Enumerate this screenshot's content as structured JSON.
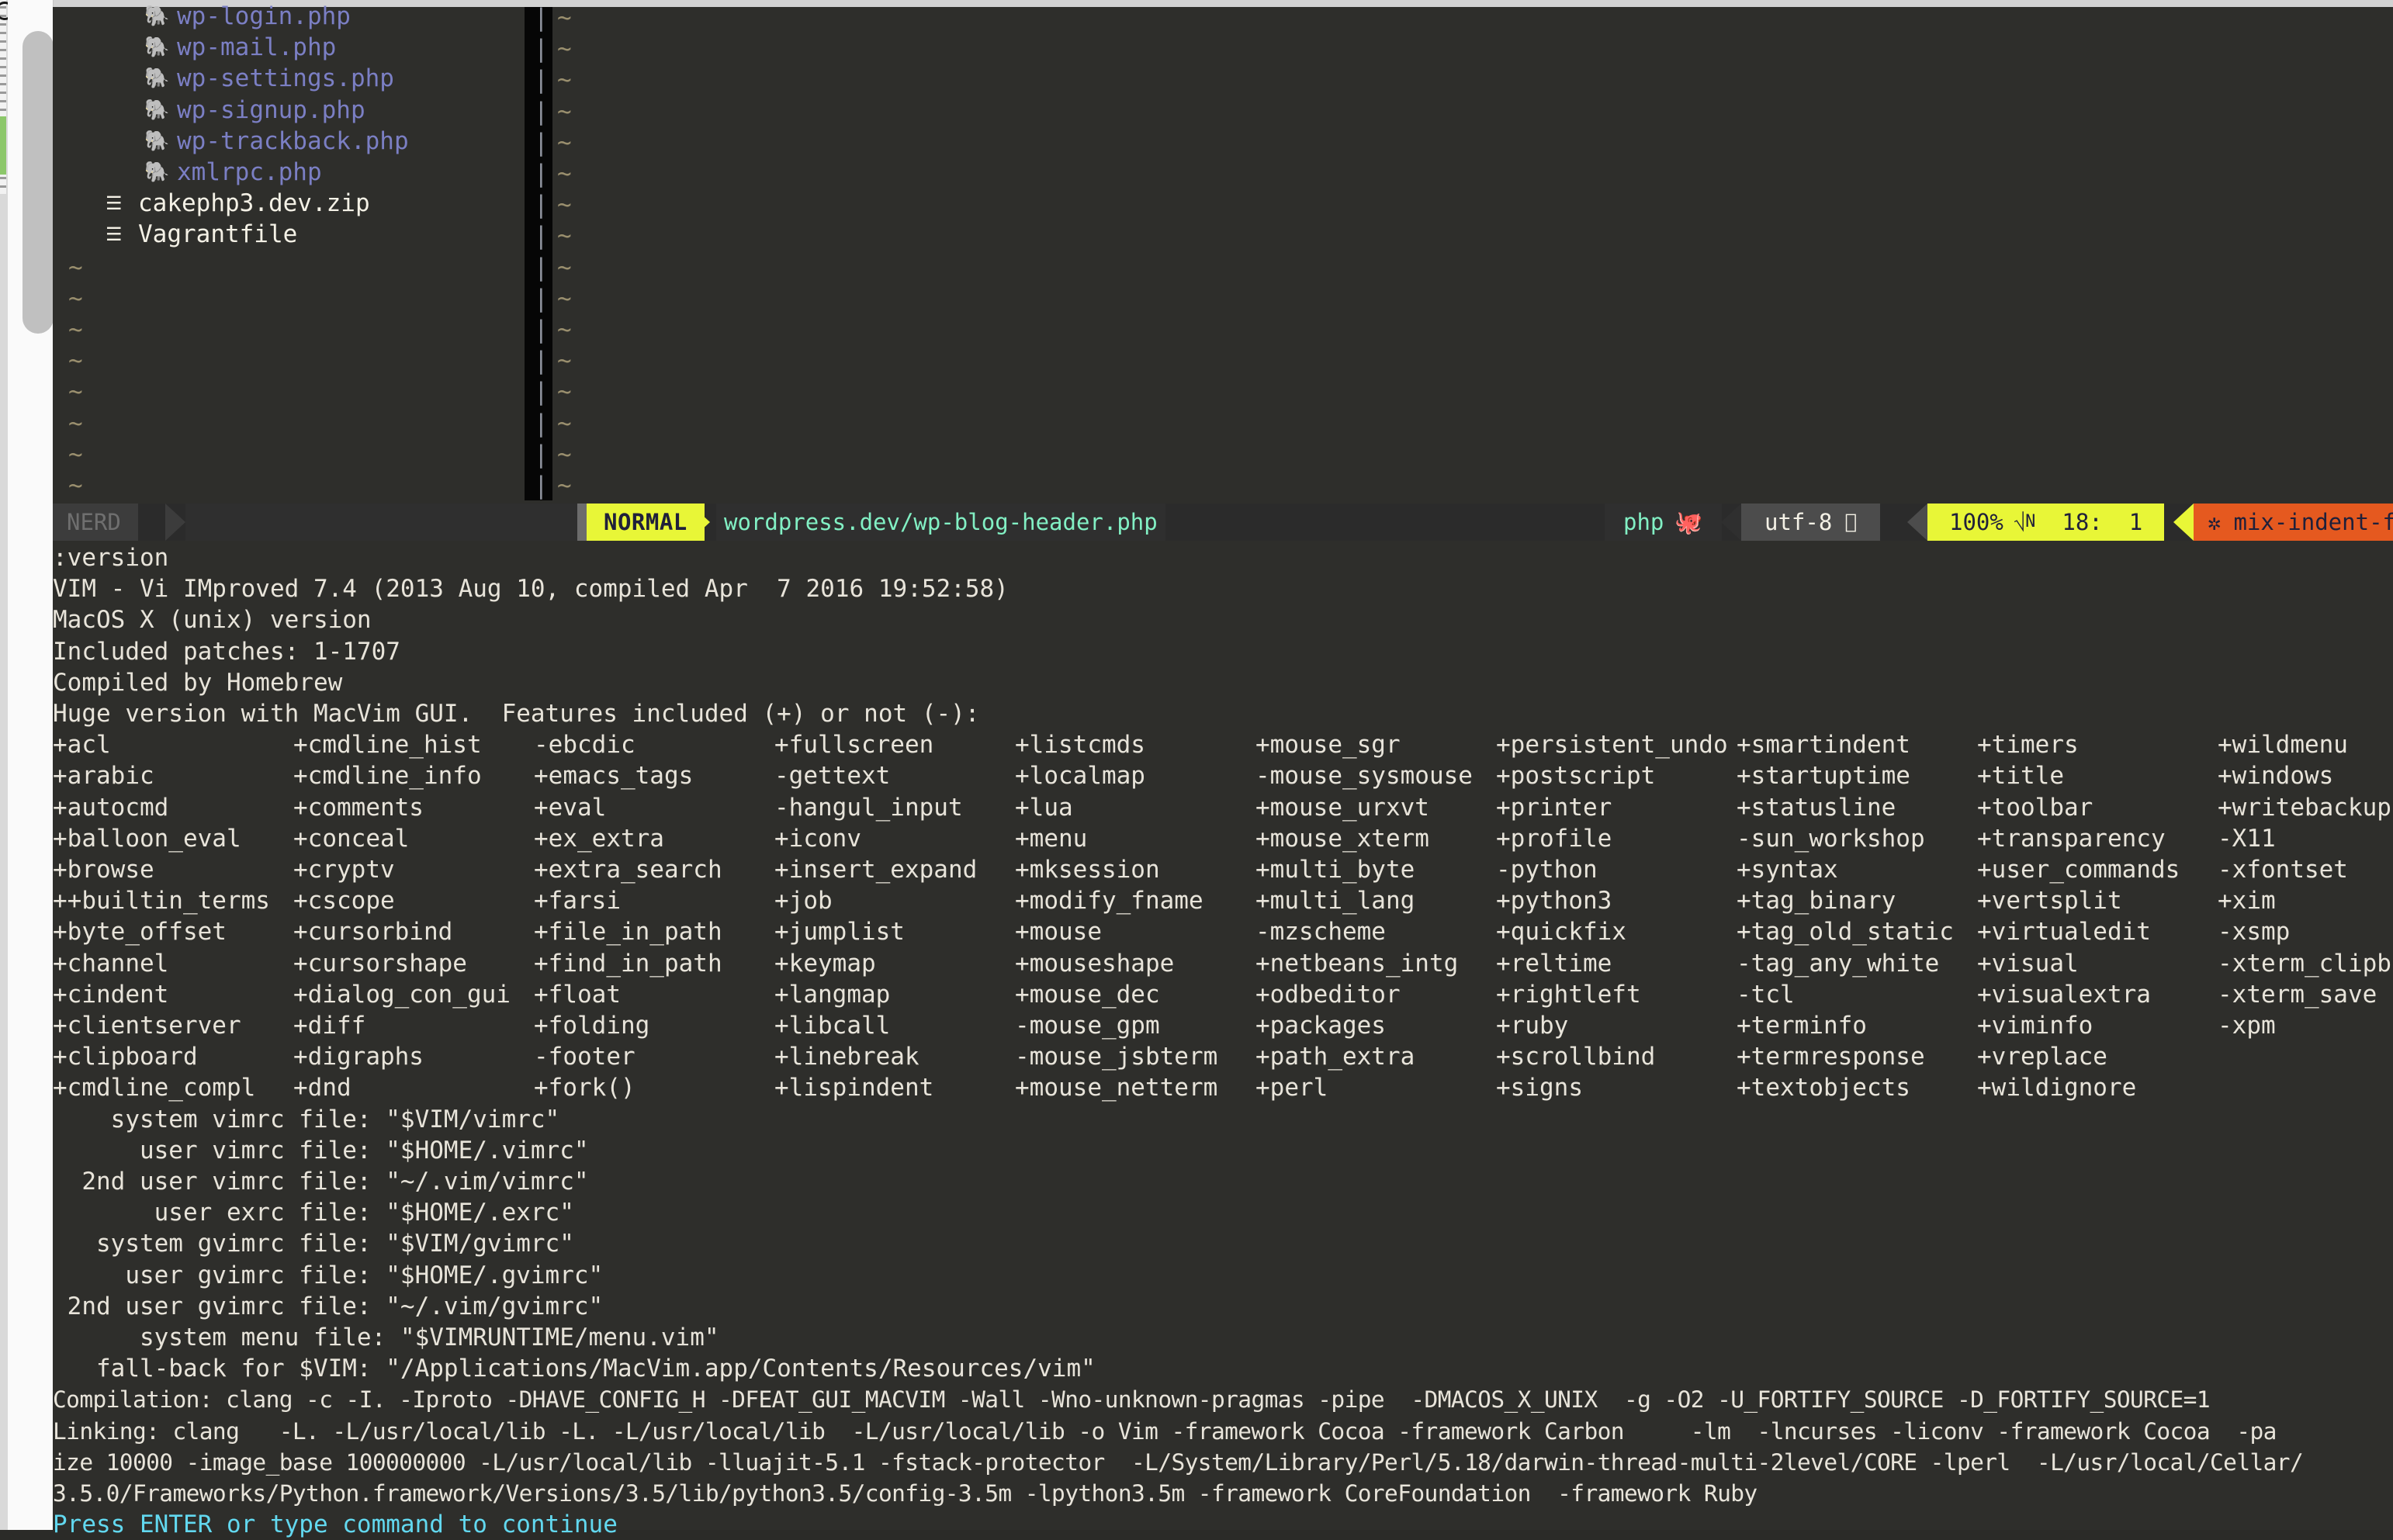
{
  "app": {
    "name": "MacVim",
    "colors": {
      "background": "#2e2e2b",
      "foreground": "#e8e4da",
      "accent_yellow": "#e8f637",
      "accent_orange": "#e5591f",
      "accent_cyan": "#82f0c4",
      "php_blue": "#7b7fc4",
      "tilde": "#9a8f6e",
      "prompt_cyan": "#62d8ef"
    }
  },
  "nerdtree": {
    "label": "NERD",
    "items": [
      {
        "icon": "php-elephant-icon",
        "name": "wp-login.php",
        "kind": "php"
      },
      {
        "icon": "php-elephant-icon",
        "name": "wp-mail.php",
        "kind": "php"
      },
      {
        "icon": "php-elephant-icon",
        "name": "wp-settings.php",
        "kind": "php"
      },
      {
        "icon": "php-elephant-icon",
        "name": "wp-signup.php",
        "kind": "php"
      },
      {
        "icon": "php-elephant-icon",
        "name": "wp-trackback.php",
        "kind": "php"
      },
      {
        "icon": "php-elephant-icon",
        "name": "xmlrpc.php",
        "kind": "php"
      },
      {
        "icon": "archive-file-icon",
        "name": "cakephp3.dev.zip",
        "kind": "file"
      },
      {
        "icon": "plain-file-icon",
        "name": "Vagrantfile",
        "kind": "file"
      }
    ],
    "empty_marker": "~",
    "empty_rows": 8
  },
  "right_buffer": {
    "split_char": "|",
    "empty_marker": "~",
    "rows": 16
  },
  "statusline": {
    "nerd_label": "NERD",
    "mode": "NORMAL",
    "path": "wordpress.dev/wp-blog-header.php",
    "filetype": "php",
    "filetype_icon": "php-elephant-icon",
    "encoding": "utf-8",
    "encoding_icon": "apple-logo-icon",
    "percent": "100%",
    "percent_icon": "line-number-icon",
    "line": "18:",
    "column": "1",
    "warning_icon": "asterisk-icon",
    "warning": "mix-indent-file"
  },
  "output": {
    "command": ":version",
    "header_lines": [
      "VIM - Vi IMproved 7.4 (2013 Aug 10, compiled Apr  7 2016 19:52:58)",
      "MacOS X (unix) version",
      "Included patches: 1-1707",
      "Compiled by Homebrew",
      "Huge version with MacVim GUI.  Features included (+) or not (-):"
    ],
    "feature_columns": [
      [
        "+acl",
        "+arabic",
        "+autocmd",
        "+balloon_eval",
        "+browse",
        "++builtin_terms",
        "+byte_offset",
        "+channel",
        "+cindent",
        "+clientserver",
        "+clipboard",
        "+cmdline_compl"
      ],
      [
        "+cmdline_hist",
        "+cmdline_info",
        "+comments",
        "+conceal",
        "+cryptv",
        "+cscope",
        "+cursorbind",
        "+cursorshape",
        "+dialog_con_gui",
        "+diff",
        "+digraphs",
        "+dnd"
      ],
      [
        "-ebcdic",
        "+emacs_tags",
        "+eval",
        "+ex_extra",
        "+extra_search",
        "+farsi",
        "+file_in_path",
        "+find_in_path",
        "+float",
        "+folding",
        "-footer",
        "+fork()"
      ],
      [
        "+fullscreen",
        "-gettext",
        "-hangul_input",
        "+iconv",
        "+insert_expand",
        "+job",
        "+jumplist",
        "+keymap",
        "+langmap",
        "+libcall",
        "+linebreak",
        "+lispindent"
      ],
      [
        "+listcmds",
        "+localmap",
        "+lua",
        "+menu",
        "+mksession",
        "+modify_fname",
        "+mouse",
        "+mouseshape",
        "+mouse_dec",
        "-mouse_gpm",
        "-mouse_jsbterm",
        "+mouse_netterm"
      ],
      [
        "+mouse_sgr",
        "-mouse_sysmouse",
        "+mouse_urxvt",
        "+mouse_xterm",
        "+multi_byte",
        "+multi_lang",
        "-mzscheme",
        "+netbeans_intg",
        "+odbeditor",
        "+packages",
        "+path_extra",
        "+perl"
      ],
      [
        "+persistent_undo",
        "+postscript",
        "+printer",
        "+profile",
        "-python",
        "+python3",
        "+quickfix",
        "+reltime",
        "+rightleft",
        "+ruby",
        "+scrollbind",
        "+signs"
      ],
      [
        "+smartindent",
        "+startuptime",
        "+statusline",
        "-sun_workshop",
        "+syntax",
        "+tag_binary",
        "+tag_old_static",
        "-tag_any_white",
        "-tcl",
        "+terminfo",
        "+termresponse",
        "+textobjects"
      ],
      [
        "+timers",
        "+title",
        "+toolbar",
        "+transparency",
        "+user_commands",
        "+vertsplit",
        "+virtualedit",
        "+visual",
        "+visualextra",
        "+viminfo",
        "+vreplace",
        "+wildignore"
      ],
      [
        "+wildmenu",
        "+windows",
        "+writebackup",
        "-X11",
        "-xfontset",
        "+xim",
        "-xsmp",
        "-xterm_clipboard",
        "-xterm_save",
        "-xpm"
      ]
    ],
    "rc_files": [
      "    system vimrc file: \"$VIM/vimrc\"",
      "      user vimrc file: \"$HOME/.vimrc\"",
      "  2nd user vimrc file: \"~/.vim/vimrc\"",
      "       user exrc file: \"$HOME/.exrc\"",
      "   system gvimrc file: \"$VIM/gvimrc\"",
      "     user gvimrc file: \"$HOME/.gvimrc\"",
      " 2nd user gvimrc file: \"~/.vim/gvimrc\"",
      "      system menu file: \"$VIMRUNTIME/menu.vim\"",
      "   fall-back for $VIM: \"/Applications/MacVim.app/Contents/Resources/vim\""
    ],
    "build_lines": [
      "Compilation: clang -c -I. -Iproto -DHAVE_CONFIG_H -DFEAT_GUI_MACVIM -Wall -Wno-unknown-pragmas -pipe  -DMACOS_X_UNIX  -g -O2 -U_FORTIFY_SOURCE -D_FORTIFY_SOURCE=1",
      "Linking: clang   -L. -L/usr/local/lib -L. -L/usr/local/lib  -L/usr/local/lib -o Vim -framework Cocoa -framework Carbon     -lm  -lncurses -liconv -framework Cocoa  -pa",
      "ize 10000 -image_base 100000000 -L/usr/local/lib -lluajit-5.1 -fstack-protector  -L/System/Library/Perl/5.18/darwin-thread-multi-2level/CORE -lperl  -L/usr/local/Cellar/",
      "3.5.0/Frameworks/Python.framework/Versions/3.5/lib/python3.5/config-3.5m -lpython3.5m -framework CoreFoundation  -framework Ruby"
    ],
    "prompt": "Press ENTER or type command to continue"
  }
}
